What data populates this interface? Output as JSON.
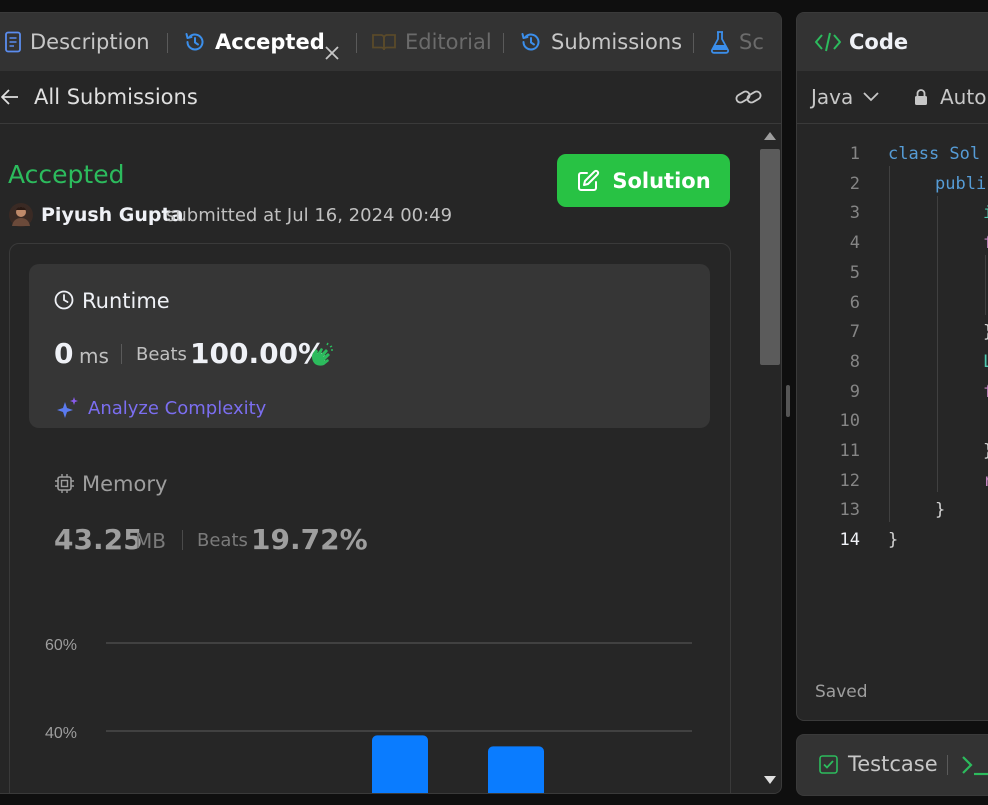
{
  "tabs": {
    "description": "Description",
    "accepted": "Accepted",
    "editorial": "Editorial",
    "submissions": "Submissions",
    "solutions_partial": "Sc"
  },
  "subheader": {
    "back_label": "All Submissions"
  },
  "submission": {
    "status": "Accepted",
    "user": "Piyush Gupta",
    "submitted_text": "submitted at Jul 16, 2024 00:49",
    "solution_button": "Solution"
  },
  "runtime": {
    "title": "Runtime",
    "value": "0",
    "unit": "ms",
    "beats_label": "Beats",
    "beats_value": "100.00%",
    "analyze_label": "Analyze Complexity"
  },
  "memory": {
    "title": "Memory",
    "value": "43.25",
    "unit": "MB",
    "beats_label": "Beats",
    "beats_value": "19.72%"
  },
  "chart_data": {
    "type": "bar",
    "y_ticks": [
      "60%",
      "40%"
    ],
    "values": [
      39,
      36.5
    ],
    "ylim": [
      0,
      60
    ],
    "color": "#0a7cff"
  },
  "code_panel": {
    "title": "Code",
    "language": "Java",
    "auto_label": "Auto",
    "line_numbers": [
      "1",
      "2",
      "3",
      "4",
      "5",
      "6",
      "7",
      "8",
      "9",
      "10",
      "11",
      "12",
      "13",
      "14"
    ],
    "line1": "class Sol",
    "line2": "publi",
    "line3": "i",
    "line4": "f",
    "line7": "}",
    "line8": "L",
    "line9": "f",
    "line11": "}",
    "line12": "r",
    "line13": "}",
    "line14": "}",
    "saved_label": "Saved"
  },
  "testcase": {
    "label": "Testcase"
  },
  "colors": {
    "accent_green": "#2cbb5d",
    "button_green": "#28c244",
    "link_purple": "#7b5cf0",
    "keyword_blue": "#569cd6",
    "clap_green": "#2cbb5d"
  }
}
